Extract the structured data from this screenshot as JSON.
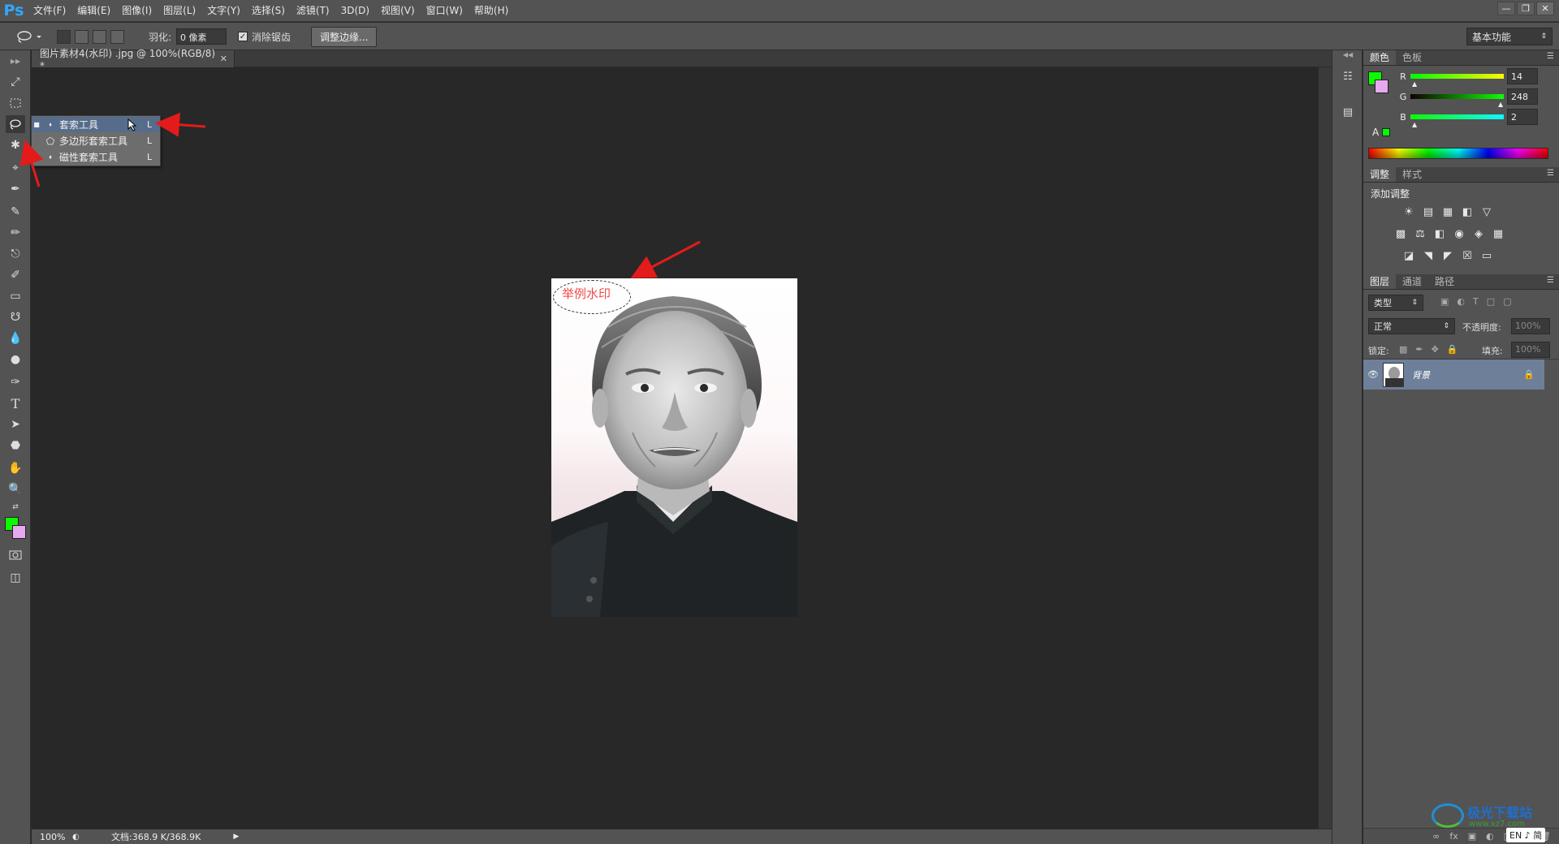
{
  "app": {
    "logo": "Ps",
    "menus": [
      "文件(F)",
      "编辑(E)",
      "图像(I)",
      "图层(L)",
      "文字(Y)",
      "选择(S)",
      "滤镜(T)",
      "3D(D)",
      "视图(V)",
      "窗口(W)",
      "帮助(H)"
    ],
    "window_controls": [
      "minimize-icon",
      "restore-icon",
      "close-icon"
    ]
  },
  "options": {
    "feather_label": "羽化:",
    "feather_value": "0 像素",
    "antialias_label": "消除锯齿",
    "antialias_checked": true,
    "refine_edge_button": "调整边缘...",
    "workspace": "基本功能"
  },
  "document": {
    "tab_title": "图片素材4(水印) .jpg @ 100%(RGB/8) *",
    "watermark_text": "举例水印",
    "zoom": "100%",
    "doc_info": "文档:368.9 K/368.9K"
  },
  "tools": {
    "fg_color": "#0ef802",
    "bg_color": "#e8a8ee"
  },
  "flyout": {
    "items": [
      {
        "label": "套索工具",
        "key": "L",
        "selected": true
      },
      {
        "label": "多边形套索工具",
        "key": "L",
        "selected": false
      },
      {
        "label": "磁性套索工具",
        "key": "L",
        "selected": false
      }
    ]
  },
  "color_panel": {
    "tabs": [
      "颜色",
      "色板"
    ],
    "r_label": "R",
    "g_label": "G",
    "b_label": "B",
    "r": 14,
    "g": 248,
    "b": 2
  },
  "adjust_panel": {
    "tabs": [
      "调整",
      "样式"
    ],
    "title": "添加调整"
  },
  "layers_panel": {
    "tabs": [
      "图层",
      "通道",
      "路径"
    ],
    "filter": "类型",
    "blend_mode": "正常",
    "opacity_label": "不透明度:",
    "opacity_value": "100%",
    "lock_label": "锁定:",
    "fill_label": "填充:",
    "fill_value": "100%",
    "layer_name": "背景"
  },
  "watermark_site": {
    "text": "极光下载站",
    "url": "www.xz7.com",
    "ime": "EN ♪ 简"
  },
  "colors": {
    "annotation_arrow": "#e31b1b",
    "watermark_text": "#f04a4a",
    "selected_row": "#566c8b"
  }
}
